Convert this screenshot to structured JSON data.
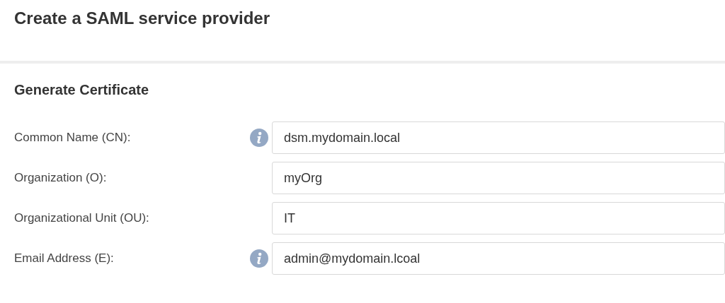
{
  "page": {
    "title": "Create a SAML service provider"
  },
  "section": {
    "title": "Generate Certificate"
  },
  "fields": [
    {
      "label": "Common Name (CN):",
      "info": true,
      "value": "dsm.mydomain.local"
    },
    {
      "label": "Organization (O):",
      "info": false,
      "value": "myOrg"
    },
    {
      "label": "Organizational Unit (OU):",
      "info": false,
      "value": "IT"
    },
    {
      "label": "Email Address (E):",
      "info": true,
      "value": "admin@mydomain.lcoal"
    }
  ]
}
